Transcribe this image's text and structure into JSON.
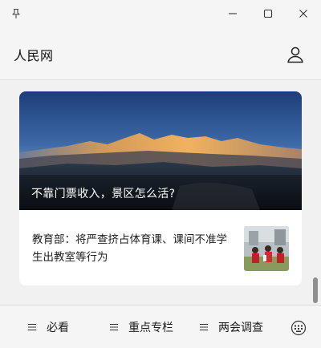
{
  "window": {
    "pin_icon": "pin-icon",
    "minimize_icon": "minimize-icon",
    "maximize_icon": "maximize-icon",
    "close_icon": "close-icon"
  },
  "header": {
    "title": "人民网",
    "user_icon": "user-icon"
  },
  "feed": {
    "hero": {
      "caption": "不靠门票收入，景区怎么活?"
    },
    "items": [
      {
        "title": "教育部：将严查挤占体育课、课间不准学生出教室等行为"
      }
    ]
  },
  "bottom_menu": {
    "items": [
      {
        "label": "必看"
      },
      {
        "label": "重点专栏"
      },
      {
        "label": "两会调查"
      }
    ],
    "keyboard_icon": "keyboard-icon"
  },
  "colors": {
    "background": "#f1f1f1",
    "card": "#ffffff",
    "scrollbar": "#8f8f8f"
  }
}
